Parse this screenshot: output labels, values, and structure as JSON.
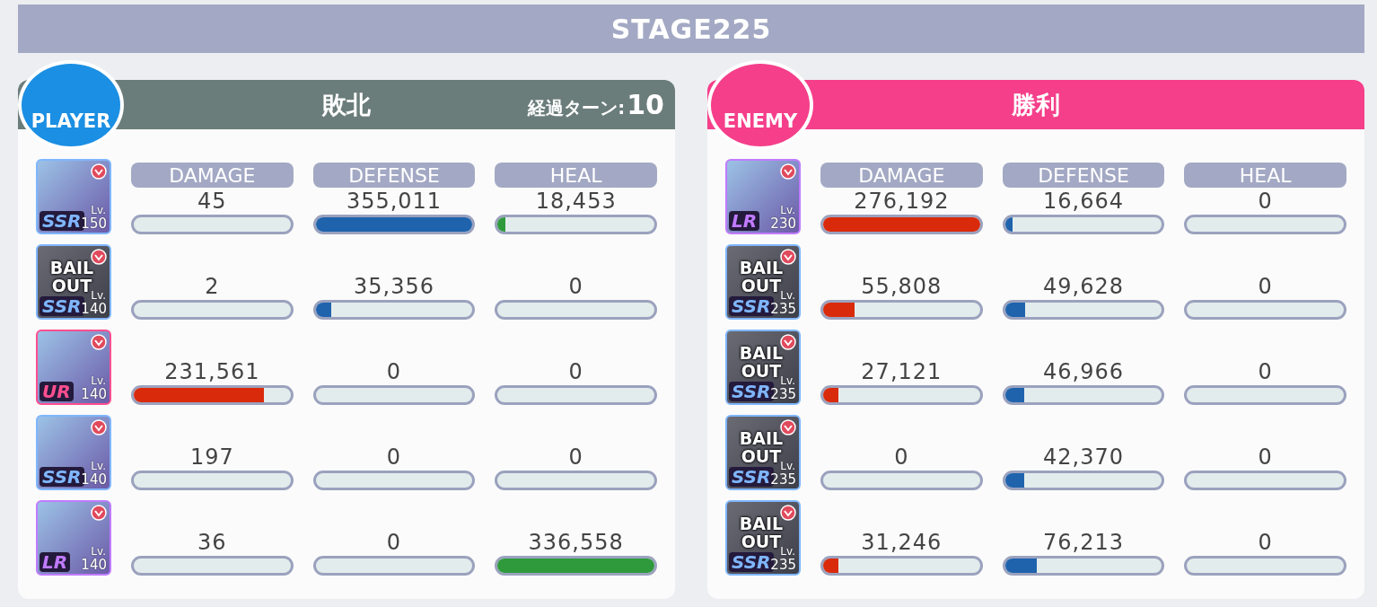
{
  "stage_title": "STAGE225",
  "panels": [
    {
      "kind": "player",
      "badge": "PLAYER",
      "result": "敗北",
      "turn_label": "経過ターン:",
      "turn_count": "10",
      "stat_headers": [
        "DAMAGE",
        "DEFENSE",
        "HEAL"
      ],
      "units": [
        {
          "rarity": "SSR",
          "lv_label": "Lv.",
          "lv": "150",
          "stats": [
            {
              "value": "45"
            },
            {
              "value": "355,011",
              "level": 1
            },
            {
              "value": "18,453",
              "level": 0.05
            }
          ]
        },
        {
          "rarity": "SSR",
          "lv_label": "Lv.",
          "lv": "140",
          "status": "BAIL OUT",
          "stats": [
            {
              "value": "2"
            },
            {
              "value": "35,356",
              "level": 0.1
            },
            {
              "value": "0"
            }
          ]
        },
        {
          "rarity": "UR",
          "lv_label": "Lv.",
          "lv": "140",
          "stats": [
            {
              "value": "231,561",
              "level": 0.83
            },
            {
              "value": "0"
            },
            {
              "value": "0"
            }
          ]
        },
        {
          "rarity": "SSR",
          "lv_label": "Lv.",
          "lv": "140",
          "stats": [
            {
              "value": "197"
            },
            {
              "value": "0"
            },
            {
              "value": "0"
            }
          ]
        },
        {
          "rarity": "LR",
          "lv_label": "Lv.",
          "lv": "140",
          "stats": [
            {
              "value": "36"
            },
            {
              "value": "0"
            },
            {
              "value": "336,558",
              "level": 1
            }
          ]
        }
      ]
    },
    {
      "kind": "enemy",
      "badge": "ENEMY",
      "result": "勝利",
      "stat_headers": [
        "DAMAGE",
        "DEFENSE",
        "HEAL"
      ],
      "units": [
        {
          "rarity": "LR",
          "lv_label": "Lv.",
          "lv": "230",
          "stats": [
            {
              "value": "276,192",
              "level": 1
            },
            {
              "value": "16,664",
              "level": 0.05
            },
            {
              "value": "0"
            }
          ]
        },
        {
          "rarity": "SSR",
          "lv_label": "Lv.",
          "lv": "235",
          "status": "BAIL OUT",
          "stats": [
            {
              "value": "55,808",
              "level": 0.2
            },
            {
              "value": "49,628",
              "level": 0.13
            },
            {
              "value": "0"
            }
          ]
        },
        {
          "rarity": "SSR",
          "lv_label": "Lv.",
          "lv": "235",
          "status": "BAIL OUT",
          "stats": [
            {
              "value": "27,121",
              "level": 0.1
            },
            {
              "value": "46,966",
              "level": 0.12
            },
            {
              "value": "0"
            }
          ]
        },
        {
          "rarity": "SSR",
          "lv_label": "Lv.",
          "lv": "235",
          "status": "BAIL OUT",
          "stats": [
            {
              "value": "0"
            },
            {
              "value": "42,370",
              "level": 0.12
            },
            {
              "value": "0"
            }
          ]
        },
        {
          "rarity": "SSR",
          "lv_label": "Lv.",
          "lv": "235",
          "status": "BAIL OUT",
          "stats": [
            {
              "value": "31,246",
              "level": 0.1
            },
            {
              "value": "76,213",
              "level": 0.2
            },
            {
              "value": "0"
            }
          ]
        }
      ]
    }
  ]
}
